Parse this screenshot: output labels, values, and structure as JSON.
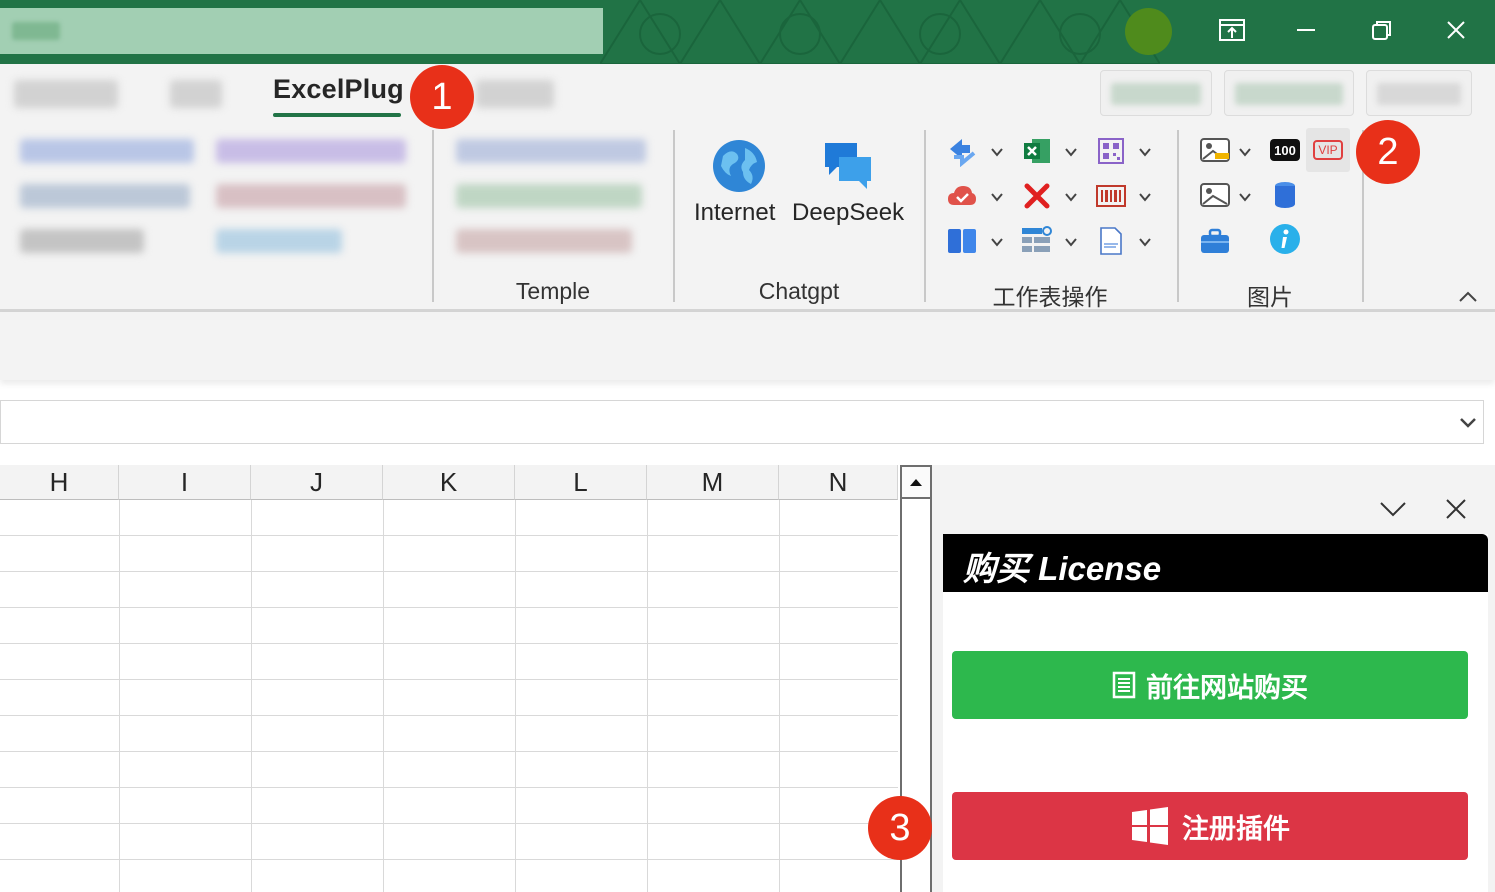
{
  "ribbon": {
    "active_tab": "ExcelPlug",
    "big_buttons": [
      {
        "label": "Internet",
        "icon": "globe-icon"
      },
      {
        "label": "DeepSeek",
        "icon": "chat-bubbles-icon"
      }
    ],
    "groups": {
      "temple": "Temple",
      "chatgpt": "Chatgpt",
      "sheet_ops": "工作表操作",
      "picture": "图片"
    },
    "small_icons": {
      "badge_100": "100",
      "vip": "VIP"
    }
  },
  "grid": {
    "columns": [
      "H",
      "I",
      "J",
      "K",
      "L",
      "M",
      "N"
    ]
  },
  "pane": {
    "title": "购买 License",
    "buy_button": "前往网站购买",
    "register_button": "注册插件"
  },
  "annotations": [
    "1",
    "2",
    "3"
  ],
  "colors": {
    "title_bar": "#217346",
    "buy_button": "#2db84d",
    "register_button": "#dc3545",
    "badge": "#e83019"
  }
}
